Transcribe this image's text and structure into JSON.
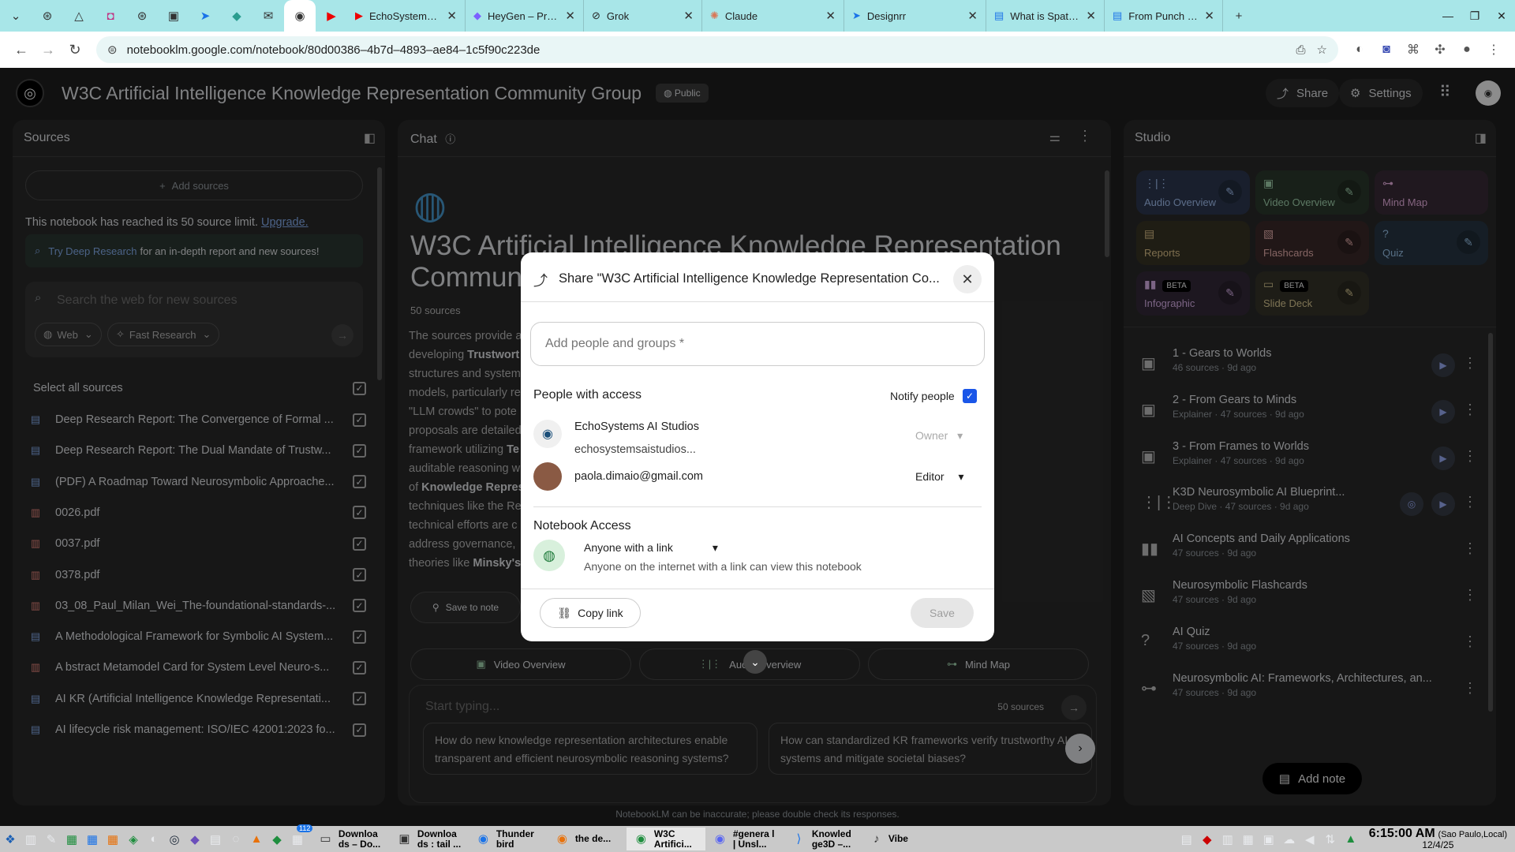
{
  "browser": {
    "pinned_tabs": [
      "chrome-menu",
      "openai",
      "google-drive",
      "instagram",
      "openai",
      "ai-app",
      "arrow-app",
      "diamond-app",
      "note-app",
      "notebooklm",
      "youtube"
    ],
    "tabs": [
      {
        "title": "EchoSystems AI St",
        "icon": "youtube"
      },
      {
        "title": "HeyGen – Project",
        "icon": "heygen"
      },
      {
        "title": "Grok",
        "icon": "grok"
      },
      {
        "title": "Claude",
        "icon": "claude"
      },
      {
        "title": "Designrr",
        "icon": "designrr"
      },
      {
        "title": "What is Spatial On",
        "icon": "doc"
      },
      {
        "title": "From Punch Card",
        "icon": "doc"
      }
    ],
    "new_tab": "+",
    "url": "notebooklm.google.com/notebook/80d00386–4b7d–4893–ae84–1c5f90c223de"
  },
  "header": {
    "title": "W3C Artificial Intelligence Knowledge Representation Community Group",
    "public_label": "Public",
    "share_label": "Share",
    "settings_label": "Settings"
  },
  "sources": {
    "title": "Sources",
    "add_label": "Add sources",
    "limit_text": "This notebook has reached its 50 source limit.",
    "upgrade_label": "Upgrade.",
    "deep_research_link": "Try Deep Research",
    "deep_research_text": "for an in-depth report and new sources!",
    "search_placeholder": "Search the web for new sources",
    "web_label": "Web",
    "fast_research_label": "Fast Research",
    "select_all": "Select all sources",
    "items": [
      {
        "label": "Deep Research Report: The Convergence of Formal ...",
        "type": "doc",
        "color": "#8ab4f8"
      },
      {
        "label": "Deep Research Report: The Dual Mandate of Trustw...",
        "type": "doc",
        "color": "#8ab4f8"
      },
      {
        "label": "(PDF) A Roadmap Toward Neurosymbolic Approache...",
        "type": "doc",
        "color": "#8ab4f8"
      },
      {
        "label": "0026.pdf",
        "type": "pdf",
        "color": "#f28b82"
      },
      {
        "label": "0037.pdf",
        "type": "pdf",
        "color": "#f28b82"
      },
      {
        "label": "0378.pdf",
        "type": "pdf",
        "color": "#f28b82"
      },
      {
        "label": "03_08_Paul_Milan_Wei_The-foundational-standards-...",
        "type": "pdf",
        "color": "#f28b82"
      },
      {
        "label": "A Methodological Framework for Symbolic AI System...",
        "type": "doc",
        "color": "#8ab4f8"
      },
      {
        "label": "A bstract Metamodel Card for System Level Neuro-s...",
        "type": "pdf",
        "color": "#f28b82"
      },
      {
        "label": "AI KR (Artificial Intelligence Knowledge Representati...",
        "type": "doc",
        "color": "#8ab4f8"
      },
      {
        "label": "AI lifecycle risk management: ISO/IEC 42001:2023 fo...",
        "type": "doc",
        "color": "#8ab4f8"
      }
    ]
  },
  "chat": {
    "title": "Chat",
    "heading_line1": "W3C Artificial Intelligence Knowledge Representation",
    "heading_line2": "Communi",
    "source_count": "50 sources",
    "body_lines": [
      {
        "text": "The sources provide a",
        "bold": ""
      },
      {
        "text": "developing ",
        "bold": "Trustwort"
      },
      {
        "text": "structures and system",
        "bold": ""
      },
      {
        "text": "models, particularly re",
        "bold": ""
      },
      {
        "text": "\"LLM crowds\" to pote",
        "bold": ""
      },
      {
        "text": "proposals are detailed",
        "bold": ""
      },
      {
        "text": "framework utilizing ",
        "bold": "Te"
      },
      {
        "text": "auditable reasoning w",
        "bold": ""
      },
      {
        "text": "of ",
        "bold": "Knowledge Repres"
      },
      {
        "text": "techniques like the Re",
        "bold": ""
      },
      {
        "text": "technical efforts are c",
        "bold": ""
      },
      {
        "text": "address governance, ",
        "bold": ""
      },
      {
        "text": "theories like ",
        "bold": "Minsky's"
      }
    ],
    "save_to_note": "Save to note",
    "quick_actions": [
      "Video Overview",
      "Audio Overview",
      "Mind Map"
    ],
    "input_placeholder": "Start typing...",
    "input_sources": "50 sources",
    "suggestions": [
      "How do new knowledge representation architectures enable transparent and efficient neurosymbolic reasoning systems?",
      "How can standardized KR frameworks verify trustworthy AI systems and mitigate societal biases?"
    ],
    "disclaimer": "NotebookLM can be inaccurate; please double check its responses."
  },
  "studio": {
    "title": "Studio",
    "tiles": [
      {
        "label": "Audio Overview",
        "icon": "audio-icon",
        "bg": "#2e3a52",
        "fg": "#a8c7fa",
        "beta": false,
        "edit": true
      },
      {
        "label": "Video Overview",
        "icon": "video-icon",
        "bg": "#2c3b2e",
        "fg": "#a8dab5",
        "beta": false,
        "edit": true
      },
      {
        "label": "Mind Map",
        "icon": "mindmap-icon",
        "bg": "#3b2c3a",
        "fg": "#f0b6e8",
        "beta": false,
        "edit": false
      },
      {
        "label": "Reports",
        "icon": "reports-icon",
        "bg": "#3a3526",
        "fg": "#e3c88e",
        "beta": false,
        "edit": false
      },
      {
        "label": "Flashcards",
        "icon": "flashcards-icon",
        "bg": "#3c2a2a",
        "fg": "#f2b8b5",
        "beta": false,
        "edit": true
      },
      {
        "label": "Quiz",
        "icon": "quiz-icon",
        "bg": "#283845",
        "fg": "#9fcbf2",
        "beta": false,
        "edit": true
      },
      {
        "label": "Infographic",
        "icon": "infographic-icon",
        "bg": "#352b3b",
        "fg": "#e0b6f0",
        "beta": true,
        "edit": true
      },
      {
        "label": "Slide Deck",
        "icon": "slides-icon",
        "bg": "#38352a",
        "fg": "#e3d29a",
        "beta": true,
        "edit": true
      }
    ],
    "beta_label": "BETA",
    "items": [
      {
        "title": "1 - Gears to Worlds",
        "subtitle": "46 sources · 9d ago",
        "icon": "video-icon",
        "play": true,
        "extra": false
      },
      {
        "title": "2 - From Gears to Minds",
        "subtitle": "Explainer · 47 sources · 9d ago",
        "icon": "video-icon",
        "play": true,
        "extra": false
      },
      {
        "title": "3 - From Frames to Worlds",
        "subtitle": "Explainer · 47 sources · 9d ago",
        "icon": "video-icon",
        "play": true,
        "extra": false
      },
      {
        "title": "K3D Neurosymbolic AI Blueprint...",
        "subtitle": "Deep Dive · 47 sources · 9d ago",
        "icon": "audio-icon",
        "play": true,
        "extra": true
      },
      {
        "title": "AI Concepts and Daily Applications",
        "subtitle": "47 sources · 9d ago",
        "icon": "infographic-icon",
        "play": false,
        "extra": false
      },
      {
        "title": "Neurosymbolic Flashcards",
        "subtitle": "47 sources · 9d ago",
        "icon": "flashcards-icon",
        "play": false,
        "extra": false
      },
      {
        "title": "AI Quiz",
        "subtitle": "47 sources · 9d ago",
        "icon": "quiz-icon",
        "play": false,
        "extra": false
      },
      {
        "title": "Neurosymbolic AI: Frameworks, Architectures, an...",
        "subtitle": "47 sources · 9d ago",
        "icon": "mindmap-icon",
        "play": false,
        "extra": false
      }
    ],
    "add_note": "Add note"
  },
  "share_dialog": {
    "title": "Share \"W3C Artificial Intelligence Knowledge Representation Co...",
    "add_people_placeholder": "Add people and groups *",
    "people_heading": "People with access",
    "notify_label": "Notify people",
    "people": [
      {
        "name": "EchoSystems AI Studios",
        "email": "echosystemsaistudios...",
        "role": "Owner"
      },
      {
        "name": "",
        "email": "paola.dimaio@gmail.com",
        "role": "Editor"
      }
    ],
    "notebook_access_heading": "Notebook Access",
    "access_option": "Anyone with a link",
    "access_desc": "Anyone on the internet with a link can view this notebook",
    "copy_link": "Copy link",
    "save": "Save"
  },
  "taskbar": {
    "items": [
      {
        "label": "Downloa ds – Do...",
        "icon": "folder"
      },
      {
        "label": "Downloa ds : tail ...",
        "icon": "terminal"
      },
      {
        "label": "Thunder bird",
        "icon": "thunderbird"
      },
      {
        "label": "the de...",
        "icon": "firefox"
      },
      {
        "label": "W3C Artifici...",
        "icon": "chrome"
      },
      {
        "label": "#genera l | Unsl...",
        "icon": "discord"
      },
      {
        "label": "Knowled ge3D –...",
        "icon": "vscode"
      },
      {
        "label": "Vibe",
        "icon": "mic"
      }
    ],
    "badge_count": "112",
    "time": "6:15:00 AM",
    "timezone": "(Sao Paulo,Local)",
    "date": "12/4/25"
  }
}
